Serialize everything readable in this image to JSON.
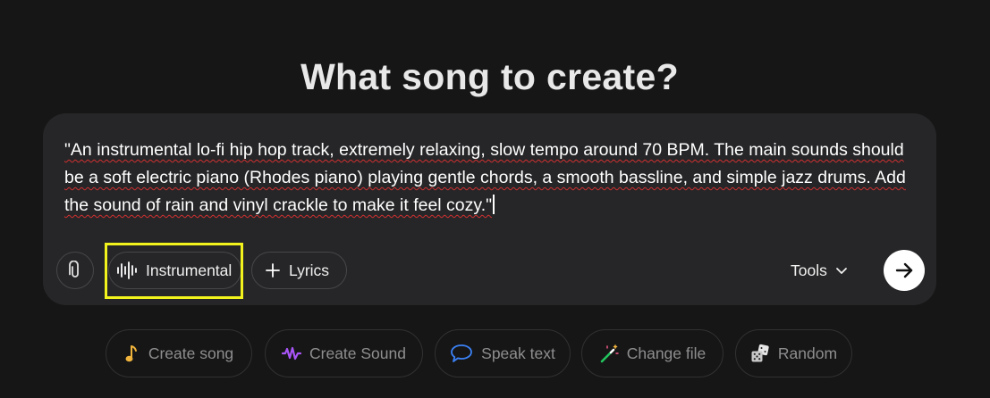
{
  "header": {
    "title": "What song to create?"
  },
  "composer": {
    "prompt": "\"An instrumental lo-fi hip hop track, extremely relaxing, slow tempo around 70 BPM. The main sounds should be a soft electric piano (Rhodes piano) playing gentle chords, a smooth bassline, and simple jazz drums. Add the sound of rain and vinyl crackle to make it feel cozy.\"",
    "chips": {
      "instrumental_label": "Instrumental",
      "lyrics_label": "Lyrics"
    },
    "tools_label": "Tools",
    "highlight_color": "#f2f21c"
  },
  "suggestions": [
    {
      "label": "Create song",
      "icon": "music-note-icon",
      "color": "#f0b43c"
    },
    {
      "label": "Create Sound",
      "icon": "waveform-icon",
      "color": "#a855f7"
    },
    {
      "label": "Speak text",
      "icon": "speech-bubble-icon",
      "color": "#3b82f6"
    },
    {
      "label": "Change file",
      "icon": "magic-wand-icon",
      "color": "#22c55e"
    },
    {
      "label": "Random",
      "icon": "dice-icon",
      "color": "#d0d0d0"
    }
  ],
  "colors": {
    "background": "#161616",
    "composer_bg": "#262628",
    "title": "#e8e8e8",
    "muted_text": "#8e8e90"
  }
}
